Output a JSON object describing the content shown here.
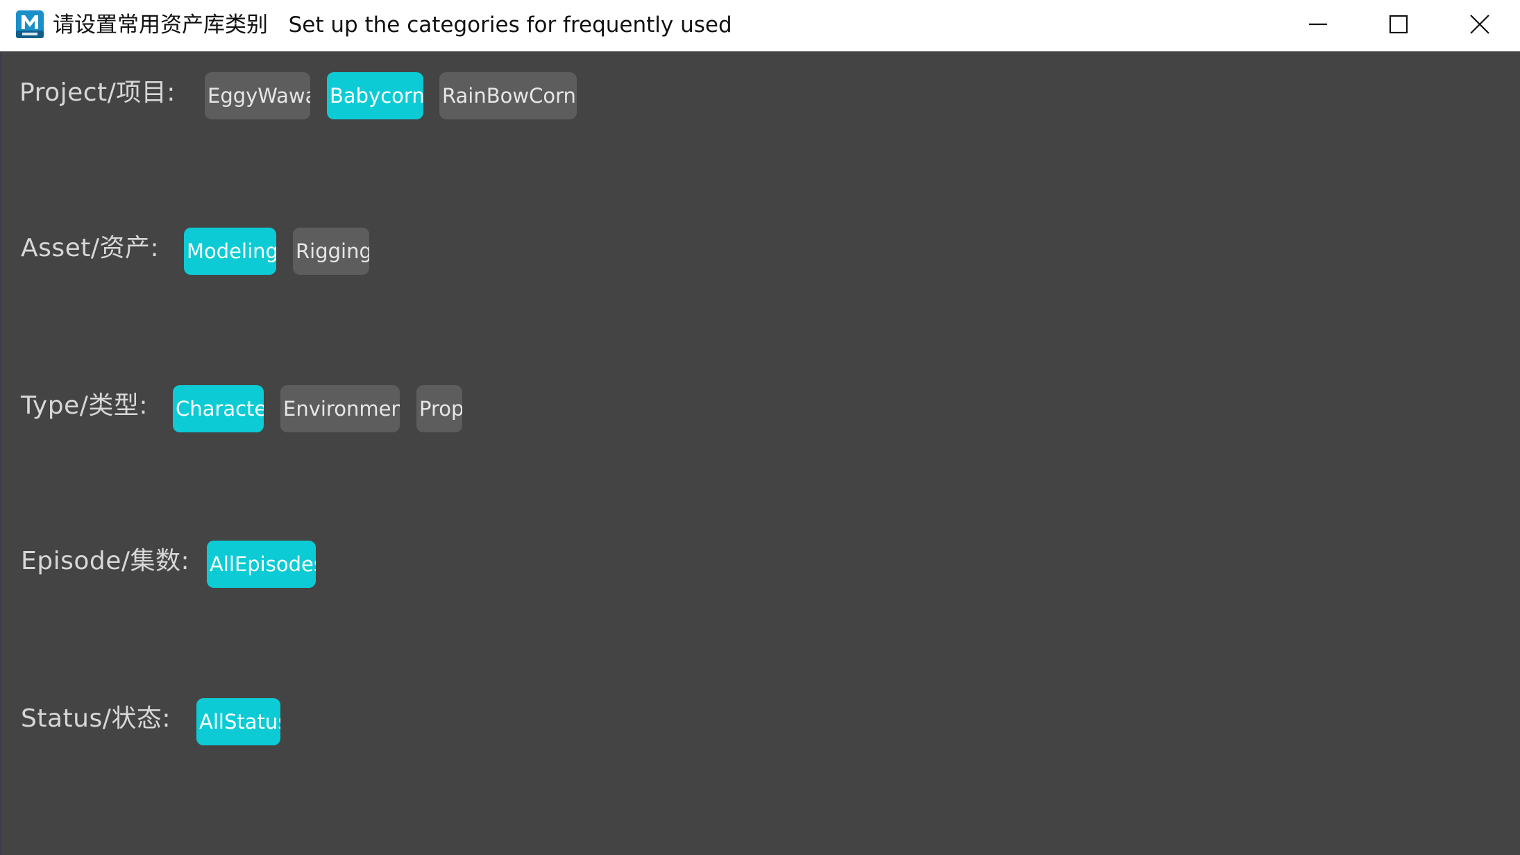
{
  "window": {
    "title_cn": "请设置常用资产库类别",
    "title_en": "Set up the categories for frequently used",
    "app_icon": "maya-app-icon",
    "controls": [
      "minimize-icon",
      "maximize-icon",
      "close-icon"
    ]
  },
  "colors": {
    "background": "#444444",
    "chip_selected": "#0ccbd5",
    "chip_unselected": "#5d5d5d",
    "label_text": "#d7d7d7"
  },
  "rows": {
    "project": {
      "label": "Project/项目:",
      "options": [
        {
          "label": "EggyWawa",
          "selected": false
        },
        {
          "label": "Babycorns",
          "selected": true
        },
        {
          "label": "RainBowCorns",
          "selected": false
        }
      ]
    },
    "asset": {
      "label": "Asset/资产:",
      "options": [
        {
          "label": "Modeling",
          "selected": true
        },
        {
          "label": "Rigging",
          "selected": false
        }
      ]
    },
    "type": {
      "label": "Type/类型:",
      "options": [
        {
          "label": "Character",
          "selected": true
        },
        {
          "label": "Environment",
          "selected": false
        },
        {
          "label": "Prop",
          "selected": false
        }
      ]
    },
    "episode": {
      "label": "Episode/集数:",
      "options": [
        {
          "label": "AllEpisodes",
          "selected": true
        }
      ]
    },
    "status": {
      "label": "Status/状态:",
      "options": [
        {
          "label": "AllStatus",
          "selected": true
        }
      ]
    }
  }
}
